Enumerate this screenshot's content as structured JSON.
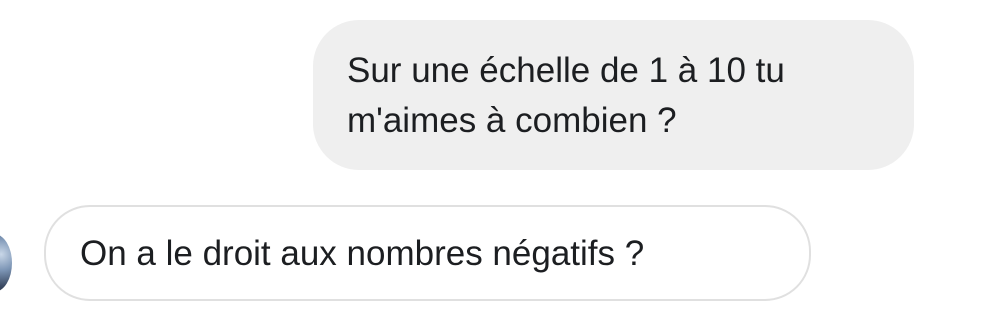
{
  "messages": {
    "sent": {
      "lines": [
        "Sur une échelle de 1 à 10 tu",
        "m'aimes à combien ?"
      ]
    },
    "received": {
      "text": "On a le droit aux nombres négatifs ?"
    }
  },
  "colors": {
    "sent_bubble_bg": "#efefef",
    "received_bubble_border": "#e0e0e0",
    "text": "#1c1e21"
  }
}
